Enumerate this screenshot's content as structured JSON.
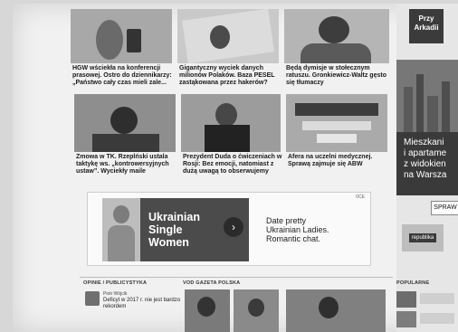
{
  "articles": [
    {
      "headline": "HGW wściekła na konferencji prasowej. Ostro do dziennikarzy: „Państwo cały czas mieli zale..."
    },
    {
      "headline": "Gigantyczny wyciek danych milionów Polaków. Baza PESEL zastąkowana przez hakerów?"
    },
    {
      "headline": "Będą dymisje w stołecznym ratuszu. Gronkiewicz-Waltz gęsto się tłumaczy"
    },
    {
      "headline": "Zmowa w TK. Rzeplński ustala taktykę ws. „kontrowersyjnych ustaw”. Wyciekły maile"
    },
    {
      "headline": "Prezydent Duda o ćwiczeniach w Rosji: Bez emocji, natomiast z dużą uwagą to obserwujemy"
    },
    {
      "headline": "Afera na uczelni medycznej. Sprawą zajmuje się ABW"
    }
  ],
  "ad": {
    "title_line1": "Ukrainian",
    "title_line2": "Single",
    "title_line3": "Women",
    "arrow": "›",
    "text_line1": "Date pretty",
    "text_line2": "Ukrainian Ladies.",
    "text_line3": "Romantic chat.",
    "tag": "0CE"
  },
  "sidebar": {
    "logo_line1": "Przy",
    "logo_line2": "Arkadii",
    "promo_line1": "Mieszkani",
    "promo_line2": "i apartame",
    "promo_line3": "z widokien",
    "promo_line4": "na Warsza",
    "button": "SPRAW",
    "partner": "republika"
  },
  "sections": {
    "opinions": "OPINIE / PUBLICYSTYKA",
    "vod": "VOD GAZETA POLSKA",
    "popular": "POPULARNE"
  },
  "opinion_item": {
    "author": "Piotr Wójcik",
    "title": "Deficyt w 2017 r. nie jest bardzo",
    "title2": "rekordem"
  },
  "colors": {
    "background": "#f1f1f1",
    "accent": "#3a3a3a"
  }
}
